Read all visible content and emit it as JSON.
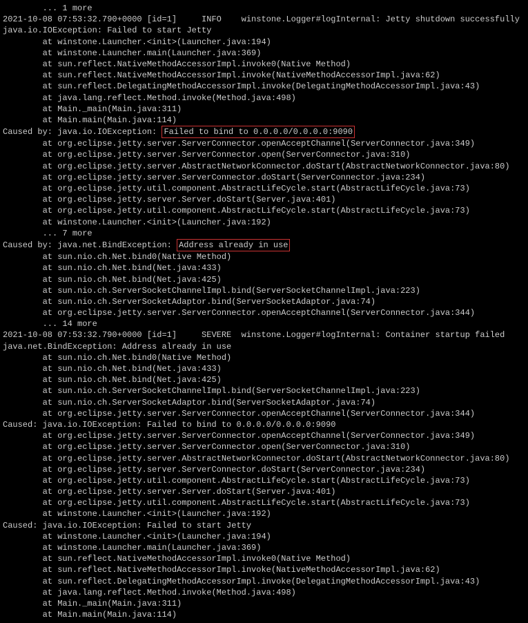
{
  "lines": [
    {
      "text": "        ... 1 more"
    },
    {
      "text": "2021-10-08 07:53:32.790+0000 [id=1]     INFO    winstone.Logger#logInternal: Jetty shutdown successfully"
    },
    {
      "text": "java.io.IOException: Failed to start Jetty"
    },
    {
      "text": "        at winstone.Launcher.<init>(Launcher.java:194)"
    },
    {
      "text": "        at winstone.Launcher.main(Launcher.java:369)"
    },
    {
      "text": "        at sun.reflect.NativeMethodAccessorImpl.invoke0(Native Method)"
    },
    {
      "text": "        at sun.reflect.NativeMethodAccessorImpl.invoke(NativeMethodAccessorImpl.java:62)"
    },
    {
      "text": "        at sun.reflect.DelegatingMethodAccessorImpl.invoke(DelegatingMethodAccessorImpl.java:43)"
    },
    {
      "text": "        at java.lang.reflect.Method.invoke(Method.java:498)"
    },
    {
      "text": "        at Main._main(Main.java:311)"
    },
    {
      "text": "        at Main.main(Main.java:114)"
    },
    {
      "prefix": "Caused by: java.io.IOException: ",
      "highlight": "Failed to bind to 0.0.0.0/0.0.0.0:9090"
    },
    {
      "text": "        at org.eclipse.jetty.server.ServerConnector.openAcceptChannel(ServerConnector.java:349)"
    },
    {
      "text": "        at org.eclipse.jetty.server.ServerConnector.open(ServerConnector.java:310)"
    },
    {
      "text": "        at org.eclipse.jetty.server.AbstractNetworkConnector.doStart(AbstractNetworkConnector.java:80)"
    },
    {
      "text": "        at org.eclipse.jetty.server.ServerConnector.doStart(ServerConnector.java:234)"
    },
    {
      "text": "        at org.eclipse.jetty.util.component.AbstractLifeCycle.start(AbstractLifeCycle.java:73)"
    },
    {
      "text": "        at org.eclipse.jetty.server.Server.doStart(Server.java:401)"
    },
    {
      "text": "        at org.eclipse.jetty.util.component.AbstractLifeCycle.start(AbstractLifeCycle.java:73)"
    },
    {
      "text": "        at winstone.Launcher.<init>(Launcher.java:192)"
    },
    {
      "text": "        ... 7 more"
    },
    {
      "prefix": "Caused by: java.net.BindException: ",
      "highlight": "Address already in use"
    },
    {
      "text": "        at sun.nio.ch.Net.bind0(Native Method)"
    },
    {
      "text": "        at sun.nio.ch.Net.bind(Net.java:433)"
    },
    {
      "text": "        at sun.nio.ch.Net.bind(Net.java:425)"
    },
    {
      "text": "        at sun.nio.ch.ServerSocketChannelImpl.bind(ServerSocketChannelImpl.java:223)"
    },
    {
      "text": "        at sun.nio.ch.ServerSocketAdaptor.bind(ServerSocketAdaptor.java:74)"
    },
    {
      "text": "        at org.eclipse.jetty.server.ServerConnector.openAcceptChannel(ServerConnector.java:344)"
    },
    {
      "text": "        ... 14 more"
    },
    {
      "text": "2021-10-08 07:53:32.790+0000 [id=1]     SEVERE  winstone.Logger#logInternal: Container startup failed"
    },
    {
      "text": "java.net.BindException: Address already in use"
    },
    {
      "text": "        at sun.nio.ch.Net.bind0(Native Method)"
    },
    {
      "text": "        at sun.nio.ch.Net.bind(Net.java:433)"
    },
    {
      "text": "        at sun.nio.ch.Net.bind(Net.java:425)"
    },
    {
      "text": "        at sun.nio.ch.ServerSocketChannelImpl.bind(ServerSocketChannelImpl.java:223)"
    },
    {
      "text": "        at sun.nio.ch.ServerSocketAdaptor.bind(ServerSocketAdaptor.java:74)"
    },
    {
      "text": "        at org.eclipse.jetty.server.ServerConnector.openAcceptChannel(ServerConnector.java:344)"
    },
    {
      "text": "Caused: java.io.IOException: Failed to bind to 0.0.0.0/0.0.0.0:9090"
    },
    {
      "text": "        at org.eclipse.jetty.server.ServerConnector.openAcceptChannel(ServerConnector.java:349)"
    },
    {
      "text": "        at org.eclipse.jetty.server.ServerConnector.open(ServerConnector.java:310)"
    },
    {
      "text": "        at org.eclipse.jetty.server.AbstractNetworkConnector.doStart(AbstractNetworkConnector.java:80)"
    },
    {
      "text": "        at org.eclipse.jetty.server.ServerConnector.doStart(ServerConnector.java:234)"
    },
    {
      "text": "        at org.eclipse.jetty.util.component.AbstractLifeCycle.start(AbstractLifeCycle.java:73)"
    },
    {
      "text": "        at org.eclipse.jetty.server.Server.doStart(Server.java:401)"
    },
    {
      "text": "        at org.eclipse.jetty.util.component.AbstractLifeCycle.start(AbstractLifeCycle.java:73)"
    },
    {
      "text": "        at winstone.Launcher.<init>(Launcher.java:192)"
    },
    {
      "text": "Caused: java.io.IOException: Failed to start Jetty"
    },
    {
      "text": "        at winstone.Launcher.<init>(Launcher.java:194)"
    },
    {
      "text": "        at winstone.Launcher.main(Launcher.java:369)"
    },
    {
      "text": "        at sun.reflect.NativeMethodAccessorImpl.invoke0(Native Method)"
    },
    {
      "text": "        at sun.reflect.NativeMethodAccessorImpl.invoke(NativeMethodAccessorImpl.java:62)"
    },
    {
      "text": "        at sun.reflect.DelegatingMethodAccessorImpl.invoke(DelegatingMethodAccessorImpl.java:43)"
    },
    {
      "text": "        at java.lang.reflect.Method.invoke(Method.java:498)"
    },
    {
      "text": "        at Main._main(Main.java:311)"
    },
    {
      "text": "        at Main.main(Main.java:114)"
    }
  ]
}
